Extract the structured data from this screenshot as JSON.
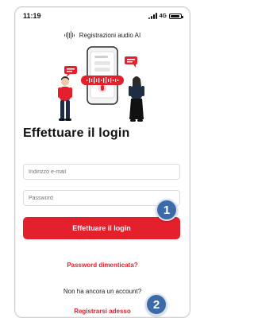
{
  "colors": {
    "accent": "#e5202d",
    "callout": "#3d6ba8",
    "input_border": "#dcdcdc"
  },
  "status_bar": {
    "time": "11:19",
    "network": "4G"
  },
  "brand": {
    "name": "Registrazioni audio AI",
    "icon": "audio-waveform-icon"
  },
  "screen": {
    "title": "Effettuare il login",
    "email_placeholder": "Indirizzo e-mail",
    "password_placeholder": "Password",
    "login_label": "Effettuare il login",
    "forgot_password": "Password dimenticata?",
    "no_account": "Non ha ancora un account?",
    "register_label": "Registrarsi adesso"
  },
  "callouts": {
    "one": "1",
    "two": "2"
  },
  "indicators": {
    "battery_level": 0.9
  }
}
